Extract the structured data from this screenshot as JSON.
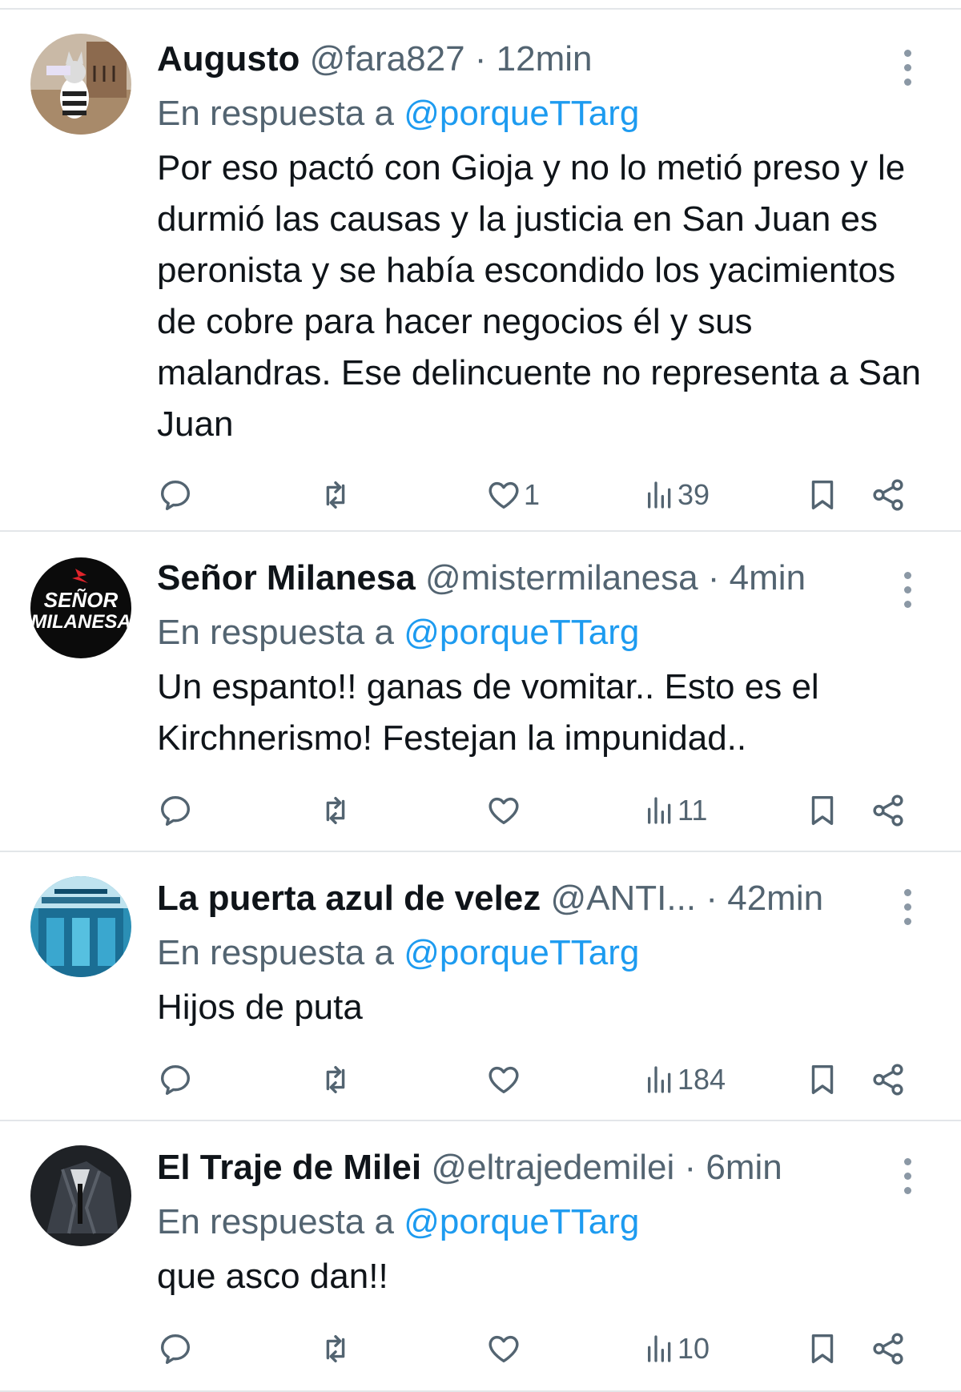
{
  "tweets": [
    {
      "name": "Augusto",
      "handle": "@fara827",
      "separator": "·",
      "time": "12min",
      "reply_prefix": "En respuesta a",
      "reply_to": "@porqueTTarg",
      "text": "Por eso pactó con Gioja y no lo metió preso y le durmió las causas y la justicia en San Juan es peronista y se había escondido los yacimientos de cobre para hacer negocios él y sus malandras. Ese delincuente no representa a San Juan",
      "likes": "1",
      "views": "39"
    },
    {
      "name": "Señor Milanesa",
      "handle": "@mistermilanesa",
      "separator": "·",
      "time": "4min",
      "reply_prefix": "En respuesta a",
      "reply_to": "@porqueTTarg",
      "text": "Un espanto!! ganas de vomitar.. Esto es el Kirchnerismo! Festejan la impunidad..",
      "likes": "",
      "views": "11",
      "avatar_text_top": "SEÑOR",
      "avatar_text_bottom": "MILANESA"
    },
    {
      "name": "La puerta azul de velez",
      "handle": "@ANTI...",
      "separator": "·",
      "time": "42min",
      "reply_prefix": "En respuesta a",
      "reply_to": "@porqueTTarg",
      "text": "Hijos de puta",
      "likes": "",
      "views": "184"
    },
    {
      "name": "El Traje de Milei",
      "handle": "@eltrajedemilei",
      "separator": "·",
      "time": "6min",
      "reply_prefix": "En respuesta a",
      "reply_to": "@porqueTTarg",
      "text": "que asco dan!!",
      "likes": "",
      "views": "10"
    }
  ],
  "icons": {
    "reply": "reply-icon",
    "retweet": "retweet-icon",
    "like": "heart-icon",
    "views": "views-icon",
    "bookmark": "bookmark-icon",
    "share": "share-icon",
    "more": "more-icon"
  },
  "colors": {
    "text": "#0f1419",
    "secondary": "#536471",
    "mention": "#1d9bf0",
    "divider": "#e3e6e9"
  }
}
